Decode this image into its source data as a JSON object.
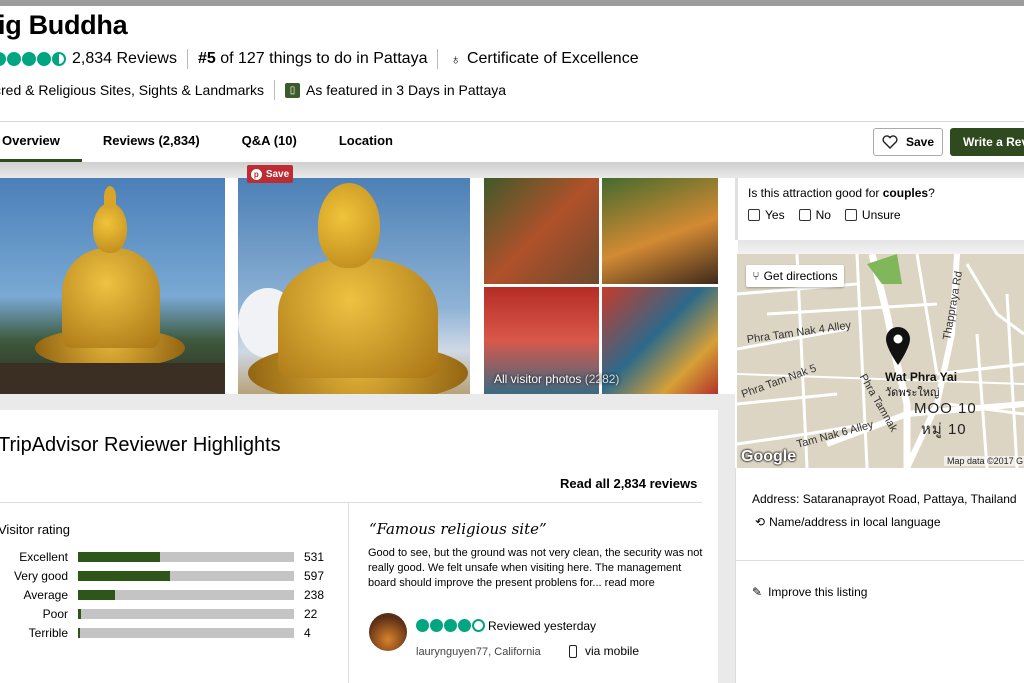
{
  "header": {
    "title": "ig Buddha",
    "reviews_count": "2,834 Reviews",
    "rank_num": "#5",
    "rank_text": "of 127 things to do in Pattaya",
    "certificate": "Certificate of Excellence",
    "categories": "cred & Religious Sites, Sights & Landmarks",
    "featured": "As featured in 3 Days in Pattaya",
    "rating_bubbles": 4.5
  },
  "tabs": [
    {
      "label": "Overview"
    },
    {
      "label": "Reviews (2,834)"
    },
    {
      "label": "Q&A (10)"
    },
    {
      "label": "Location"
    }
  ],
  "actions": {
    "save_label": "Save",
    "write_label": "Write a Rev"
  },
  "photos": {
    "pin_save": "Save",
    "all_photos_label": "All visitor photos",
    "all_photos_count": "(2282)"
  },
  "couples": {
    "question_prefix": "Is this attraction good for ",
    "question_emph": "couples",
    "question_suffix": "?",
    "options": [
      "Yes",
      "No",
      "Unsure"
    ]
  },
  "map": {
    "directions": "Get directions",
    "streets": [
      "Phra Tam Nak 4 Alley",
      "Phra Tam Nak 5",
      "Phra Tamnak",
      "Tam Nak 6 Alley",
      "Thappraya Rd"
    ],
    "poi_name": "Wat Phra Yai",
    "poi_thai": "วัดพระใหญ่",
    "moo_en": "MOO 10",
    "moo_th": "หมู่ 10",
    "google": "Google",
    "mapdata": "Map data ©2017 G"
  },
  "location": {
    "address": "Address: Sataranaprayot Road, Pattaya, Thailand",
    "local_name": "Name/address in local language",
    "improve": "Improve this listing"
  },
  "highlights": {
    "title": "TripAdvisor Reviewer Highlights",
    "read_all": "Read all 2,834 reviews",
    "visitor_rating_title": "Visitor rating",
    "ratings": [
      {
        "label": "Excellent",
        "count": "531",
        "value": 531
      },
      {
        "label": "Very good",
        "count": "597",
        "value": 597
      },
      {
        "label": "Average",
        "count": "238",
        "value": 238
      },
      {
        "label": "Poor",
        "count": "22",
        "value": 22
      },
      {
        "label": "Terrible",
        "count": "4",
        "value": 4
      }
    ],
    "rating_max": 1400
  },
  "review": {
    "quote": "“Famous religious site”",
    "body": "Good to see, but the ground was not very clean, the security was not really good. We felt unsafe when visiting here. The management board should improve the present problens for...",
    "read_more": "read more",
    "bubbles": 4,
    "date": "Reviewed yesterday",
    "user": "laurynguyen77, California",
    "via": "via mobile"
  },
  "colors": {
    "brand_green": "#00a680",
    "dark_green": "#2e4a1e",
    "pin_red": "#bd2c32"
  }
}
